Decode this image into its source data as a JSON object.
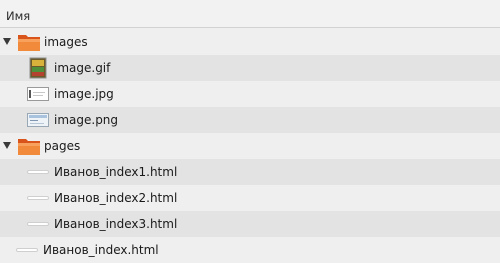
{
  "header": {
    "column_name": "Имя"
  },
  "tree": {
    "images": {
      "label": "images",
      "children": [
        "image.gif",
        "image.jpg",
        "image.png"
      ]
    },
    "pages": {
      "label": "pages",
      "children": [
        "Иванов_index1.html",
        "Иванов_index2.html",
        "Иванов_index3.html"
      ]
    },
    "root_file": "Иванов_index.html"
  },
  "colors": {
    "folder_dark": "#e8641a",
    "folder_light": "#f7a15c",
    "row_alt": "#e3e3e3",
    "row_base": "#efefef"
  }
}
